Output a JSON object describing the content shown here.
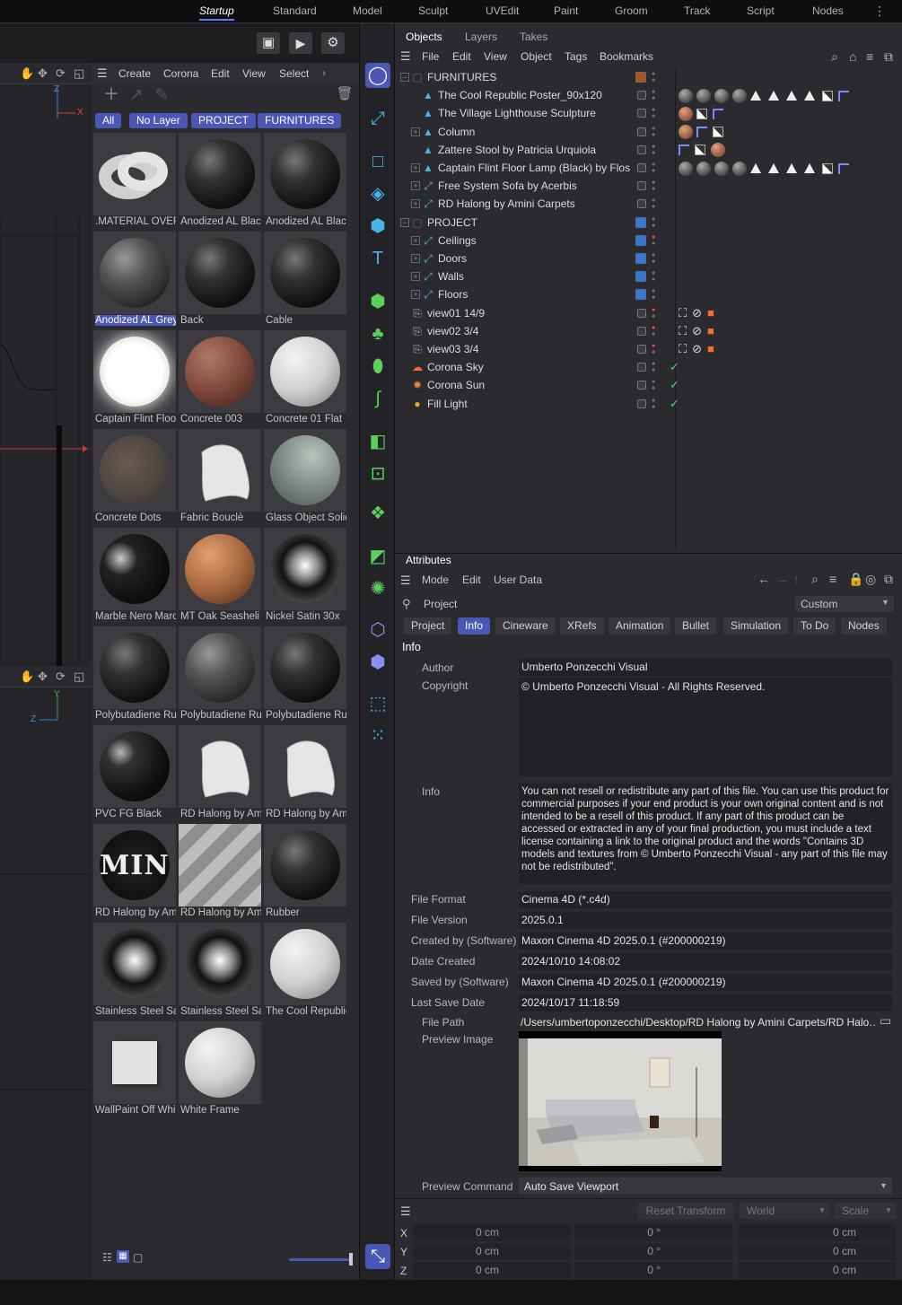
{
  "layouts": [
    "Startup",
    "Standard",
    "Model",
    "Sculpt",
    "UVEdit",
    "Paint",
    "Groom",
    "Track",
    "Script",
    "Nodes"
  ],
  "active_layout": "Startup",
  "kebab": "⋮",
  "viewport": {
    "axis_top": {
      "z": "Z",
      "y": "Y",
      "x": "X"
    },
    "axis_bottom": {
      "y": "Y",
      "z": "Z"
    }
  },
  "materials": {
    "menu": [
      "Create",
      "Corona",
      "Edit",
      "View",
      "Select"
    ],
    "more": "›",
    "filters": [
      "All",
      "No Layer",
      "PROJECT",
      "FURNITURES"
    ],
    "items": [
      {
        "label": ".MATERIAL OVERRIDE",
        "style": "knot"
      },
      {
        "label": "Anodized AL Black",
        "style": "black"
      },
      {
        "label": "Anodized AL Black",
        "style": "black"
      },
      {
        "label": "Anodized AL Grey",
        "style": "grey",
        "selected": true
      },
      {
        "label": "Back",
        "style": "black"
      },
      {
        "label": "Cable",
        "style": "black"
      },
      {
        "label": "Captain Flint Floor",
        "style": "glow"
      },
      {
        "label": "Concrete 003",
        "style": "clay"
      },
      {
        "label": "Concrete 01 Flat",
        "style": "white"
      },
      {
        "label": "Concrete Dots",
        "style": "dots"
      },
      {
        "label": "Fabric Bouclè",
        "style": "cloth"
      },
      {
        "label": "Glass Object Solid",
        "style": "glass"
      },
      {
        "label": "Marble Nero Marquina",
        "style": "marble"
      },
      {
        "label": "MT Oak Seasheli",
        "style": "wood"
      },
      {
        "label": "Nickel Satin 30x",
        "style": "chrome"
      },
      {
        "label": "Polybutadiene Rubber",
        "style": "black"
      },
      {
        "label": "Polybutadiene Rubber",
        "style": "grey"
      },
      {
        "label": "Polybutadiene Rubber",
        "style": "black"
      },
      {
        "label": "PVC FG Black",
        "style": "gloss"
      },
      {
        "label": "RD Halong by Amini",
        "style": "cloth"
      },
      {
        "label": "RD Halong by Amini",
        "style": "cloth"
      },
      {
        "label": "RD Halong by Amini",
        "style": "logo"
      },
      {
        "label": "RD Halong by Amini",
        "style": "stripe"
      },
      {
        "label": "Rubber",
        "style": "black"
      },
      {
        "label": "Stainless Steel Satin",
        "style": "chrome"
      },
      {
        "label": "Stainless Steel Satin",
        "style": "chrome"
      },
      {
        "label": "The Cool Republic",
        "style": "white"
      },
      {
        "label": "WallPaint Off White",
        "style": "cube"
      },
      {
        "label": "White Frame",
        "style": "white"
      }
    ],
    "logo_text": "MIN"
  },
  "objects": {
    "tabs": [
      "Objects",
      "Layers",
      "Takes"
    ],
    "menu": [
      "File",
      "Edit",
      "View",
      "Object",
      "Tags",
      "Bookmarks"
    ],
    "rows": [
      {
        "name": "FURNITURES",
        "indent": 0,
        "kind": "null",
        "expand": "−",
        "layer": "#9a5a2e"
      },
      {
        "name": "The Cool Republic Poster_90x120",
        "indent": 1,
        "kind": "cone",
        "chk": true,
        "tags": "m4t4q"
      },
      {
        "name": "The Village Lighthouse Sculpture",
        "indent": 1,
        "kind": "cone",
        "chk": true,
        "tags": "c1qf"
      },
      {
        "name": "Column",
        "indent": 1,
        "kind": "cone",
        "expand": "+",
        "chk": true,
        "tags": "fq"
      },
      {
        "name": "Zattere Stool by Patricia Urquiola",
        "indent": 1,
        "kind": "cone",
        "chk": true,
        "tags": "fqm"
      },
      {
        "name": "Captain Flint Floor Lamp (Black) by Flos",
        "indent": 1,
        "kind": "cone",
        "expand": "+",
        "chk": true,
        "tags": "m4t4q"
      },
      {
        "name": "Free System Sofa by Acerbis",
        "indent": 1,
        "kind": "group",
        "expand": "+",
        "chk": true
      },
      {
        "name": "RD Halong by Amini Carpets",
        "indent": 1,
        "kind": "group",
        "expand": "+",
        "chk": true
      },
      {
        "name": "PROJECT",
        "indent": 0,
        "kind": "null",
        "expand": "−",
        "layer": "#3a76c4"
      },
      {
        "name": "Ceilings",
        "indent": 1,
        "kind": "group",
        "expand": "+",
        "layer": "#3a76c4",
        "red": true
      },
      {
        "name": "Doors",
        "indent": 1,
        "kind": "group",
        "expand": "+",
        "layer": "#3a76c4"
      },
      {
        "name": "Walls",
        "indent": 1,
        "kind": "group",
        "expand": "+",
        "layer": "#3a76c4"
      },
      {
        "name": "Floors",
        "indent": 1,
        "kind": "group",
        "expand": "+",
        "layer": "#3a76c4"
      },
      {
        "name": "view01 14/9",
        "indent": 0,
        "kind": "cam",
        "chk": true,
        "red": true,
        "cam": true
      },
      {
        "name": "view02 3/4",
        "indent": 0,
        "kind": "cam",
        "chk": true,
        "red": true,
        "cam": true
      },
      {
        "name": "view03 3/4",
        "indent": 0,
        "kind": "cam",
        "chk": true,
        "red": true,
        "cam": true
      },
      {
        "name": "Corona Sky",
        "indent": 0,
        "kind": "sky",
        "chk": true,
        "ok": true
      },
      {
        "name": "Corona Sun",
        "indent": 0,
        "kind": "sun",
        "chk": true,
        "ok": true
      },
      {
        "name": "Fill Light",
        "indent": 0,
        "kind": "light",
        "chk": true,
        "ok": true
      }
    ]
  },
  "attributes": {
    "title": "Attributes",
    "menu": [
      "Mode",
      "Edit",
      "User Data"
    ],
    "object": "Project",
    "preset": "Custom",
    "tabs": [
      "Project",
      "Info",
      "Cineware",
      "XRefs",
      "Animation",
      "Bullet",
      "Simulation",
      "To Do",
      "Nodes"
    ],
    "active_tab": "Info",
    "section": "Info",
    "author_label": "Author",
    "author": "Umberto Ponzecchi Visual",
    "copyright_label": "Copyright",
    "copyright": "© Umberto Ponzecchi Visual - All Rights Reserved.",
    "info_label": "Info",
    "info": "You can not resell or redistribute any part of this file. You can use this product for commercial purposes if your end product is your own original content and is not intended to be a resell of this product. If any part of this product can be accessed or extracted in any of your final production, you must include a text license containing a link to the original product and the words \"Contains 3D models and textures from © Umberto Ponzecchi Visual - any part of this file may not be redistributed\".",
    "fields": [
      {
        "label": "File Format",
        "value": "Cinema 4D (*.c4d)"
      },
      {
        "label": "File Version",
        "value": "2025.0.1"
      },
      {
        "label": "Created by (Software)",
        "value": "Maxon Cinema 4D 2025.0.1 (#200000219)"
      },
      {
        "label": "Date Created",
        "value": "2024/10/10 14:08:02"
      },
      {
        "label": "Saved by (Software)",
        "value": "Maxon Cinema 4D 2025.0.1 (#200000219)"
      },
      {
        "label": "Last Save Date",
        "value": "2024/10/17 11:18:59"
      }
    ],
    "file_path_label": "File Path",
    "file_path": "/Users/umbertoponzecchi/Desktop/RD Halong by Amini Carpets/RD Halo…",
    "preview_label": "Preview Image",
    "preview_cmd_label": "Preview Command",
    "preview_cmd": "Auto Save Viewport"
  },
  "coords": {
    "reset": "Reset Transform",
    "space": "World",
    "mode": "Scale",
    "rows": [
      {
        "axis": "X",
        "p": "0 cm",
        "r": "0 °",
        "s": "0 cm"
      },
      {
        "axis": "Y",
        "p": "0 cm",
        "r": "0 °",
        "s": "0 cm"
      },
      {
        "axis": "Z",
        "p": "0 cm",
        "r": "0 °",
        "s": "0 cm"
      }
    ]
  },
  "colors": {
    "accent": "#4a57b6",
    "tool": "#49b4e8",
    "ok": "#4cd97b",
    "rec": "#e25a3a"
  }
}
